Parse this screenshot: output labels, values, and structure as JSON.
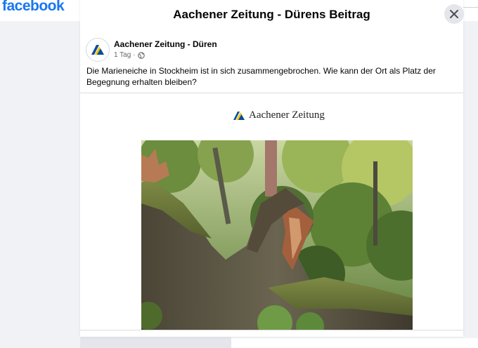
{
  "facebook": {
    "logo": "facebook"
  },
  "modal": {
    "title": "Aachener Zeitung - Dürens Beitrag",
    "close_icon": "close-icon"
  },
  "post": {
    "page_name": "Aachener Zeitung - Düren",
    "time": "1 Tag",
    "separator": "·",
    "privacy_icon": "globe-icon",
    "text": "Die Marieneiche in Stockheim ist in sich zusammengebrochen. Wie kann der Ort als Platz der Begegnung erhalten bleiben?",
    "media": {
      "brand": "Aachener Zeitung",
      "image": "collapsed-oak-tree-photo"
    }
  },
  "colors": {
    "facebook_blue": "#1877f2",
    "logo_blue": "#0a4e9b",
    "logo_yellow": "#f5c400"
  }
}
